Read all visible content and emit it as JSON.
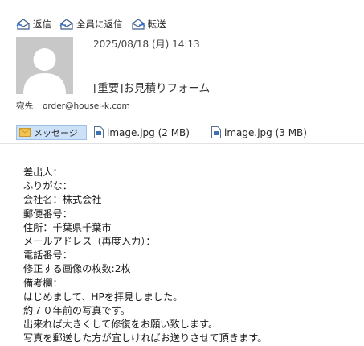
{
  "toolbar": {
    "reply_label": "返信",
    "reply_all_label": "全員に返信",
    "forward_label": "転送"
  },
  "header": {
    "date": "2025/08/18 (月) 14:13",
    "subject": "[重要]お見積りフォーム",
    "to_label": "宛先",
    "to_address": "order@housei-k.com"
  },
  "attachments": {
    "message_tab": "メッセージ",
    "items": [
      {
        "label": "image.jpg (2 MB)"
      },
      {
        "label": "image.jpg (3 MB)"
      }
    ]
  },
  "body": {
    "lines": [
      "差出人：",
      "ふりがな：",
      "会社名：株式会社",
      "郵便番号：",
      "住所：千葉県千葉市",
      "メールアドレス（再度入力）：",
      "電話番号：",
      "修正する画像の枚数:2枚",
      "備考欄：",
      "はじめまして、HPを拝見しました。",
      "約７０年前の写真です。",
      "出来れば大きくして修復をお願い致します。",
      "写真を郵送した方が宜しければお送りさせて頂きます。"
    ]
  },
  "colors": {
    "selected_tab_bg": "#cce1f7",
    "avatar_bg": "#c8c8c8",
    "icon_blue": "#3f5f8a"
  },
  "icons": [
    "reply-icon",
    "reply-all-icon",
    "forward-icon",
    "envelope-icon",
    "file-icon",
    "avatar-silhouette-icon"
  ]
}
